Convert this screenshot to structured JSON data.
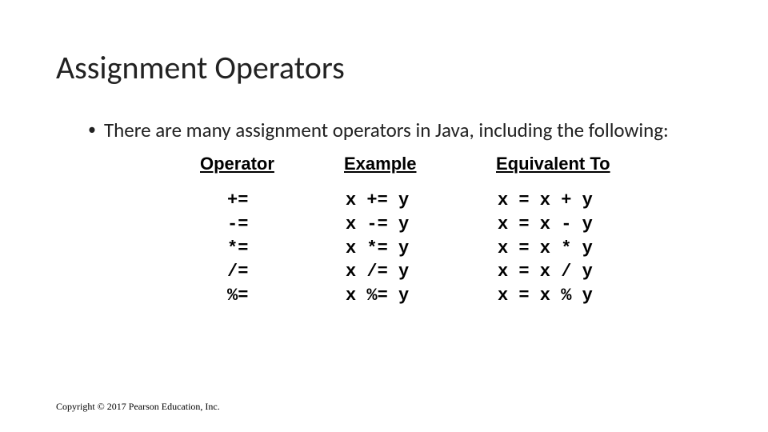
{
  "title": "Assignment Operators",
  "bullet": "There are many assignment operators in Java, including the following:",
  "headers": {
    "operator": "Operator",
    "example": "Example",
    "equivalent": "Equivalent To"
  },
  "rows": [
    {
      "op": "+=",
      "ex": "x += y",
      "eq": "x = x + y"
    },
    {
      "op": "-=",
      "ex": "x -= y",
      "eq": "x = x - y"
    },
    {
      "op": "*=",
      "ex": "x *= y",
      "eq": "x = x * y"
    },
    {
      "op": "/=",
      "ex": "x /= y",
      "eq": "x = x / y"
    },
    {
      "op": "%=",
      "ex": "x %= y",
      "eq": "x = x % y"
    }
  ],
  "copyright": "Copyright © 2017 Pearson Education, Inc."
}
